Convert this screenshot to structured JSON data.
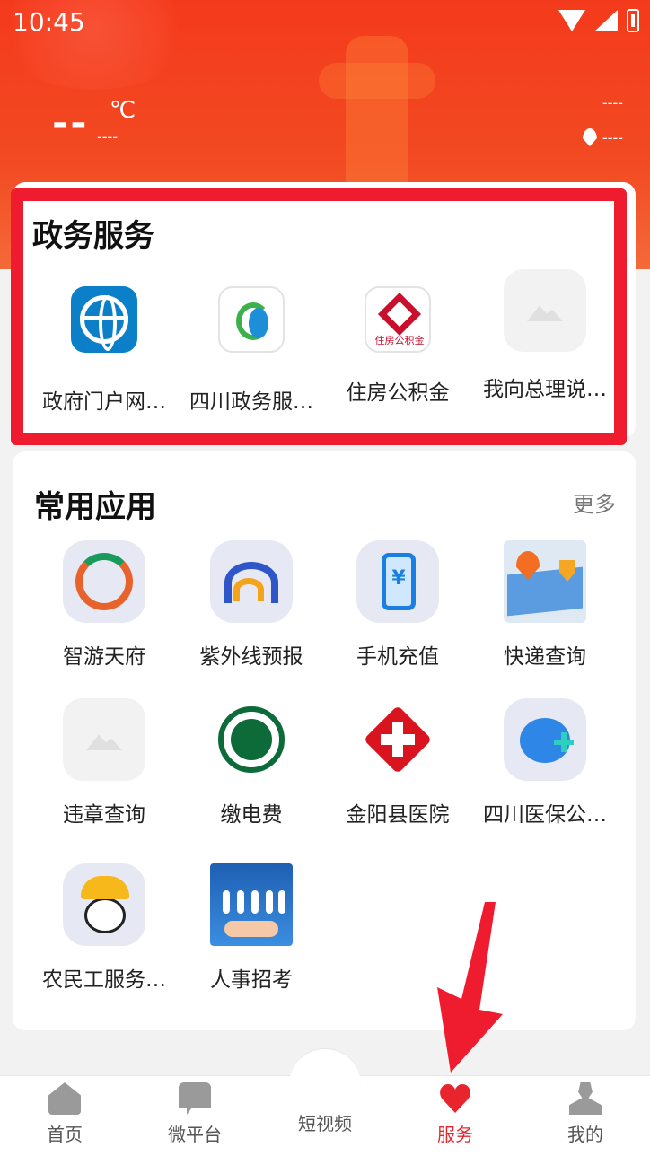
{
  "status_bar": {
    "time": "10:45"
  },
  "weather": {
    "temp": "--",
    "unit": "℃",
    "desc": "----"
  },
  "location": {
    "top": "----",
    "bottom": "----"
  },
  "gov_services": {
    "title": "政务服务",
    "items": [
      {
        "label": "政府门户网…",
        "icon": "globe-icon"
      },
      {
        "label": "四川政务服…",
        "icon": "sichuan-gov-icon"
      },
      {
        "label": "住房公积金",
        "icon": "housing-fund-icon",
        "icon_text": "住房公积金"
      },
      {
        "label": "我向总理说…",
        "icon": "image-placeholder-icon"
      }
    ]
  },
  "common_apps": {
    "title": "常用应用",
    "more": "更多",
    "items": [
      {
        "label": "智游天府",
        "icon": "zhiyou-icon"
      },
      {
        "label": "紫外线预报",
        "icon": "uv-forecast-icon"
      },
      {
        "label": "手机充值",
        "icon": "phone-recharge-icon",
        "icon_text": "¥"
      },
      {
        "label": "快递查询",
        "icon": "express-map-icon"
      },
      {
        "label": "违章查询",
        "icon": "image-placeholder-icon"
      },
      {
        "label": "缴电费",
        "icon": "state-grid-icon"
      },
      {
        "label": "金阳县医院",
        "icon": "hospital-icon"
      },
      {
        "label": "四川医保公…",
        "icon": "medical-insurance-icon"
      },
      {
        "label": "农民工服务…",
        "icon": "migrant-worker-icon"
      },
      {
        "label": "人事招考",
        "icon": "hr-exam-icon"
      }
    ]
  },
  "bottom_nav": {
    "items": [
      {
        "label": "首页",
        "icon": "home-icon"
      },
      {
        "label": "微平台",
        "icon": "chat-icon"
      },
      {
        "label": "短视频",
        "icon": "video-icon"
      },
      {
        "label": "服务",
        "icon": "heart-icon",
        "active": true
      },
      {
        "label": "我的",
        "icon": "user-icon"
      }
    ]
  },
  "colors": {
    "brand_red": "#f43a1c",
    "highlight": "#ee1c2e",
    "active_nav": "#e8242c"
  }
}
